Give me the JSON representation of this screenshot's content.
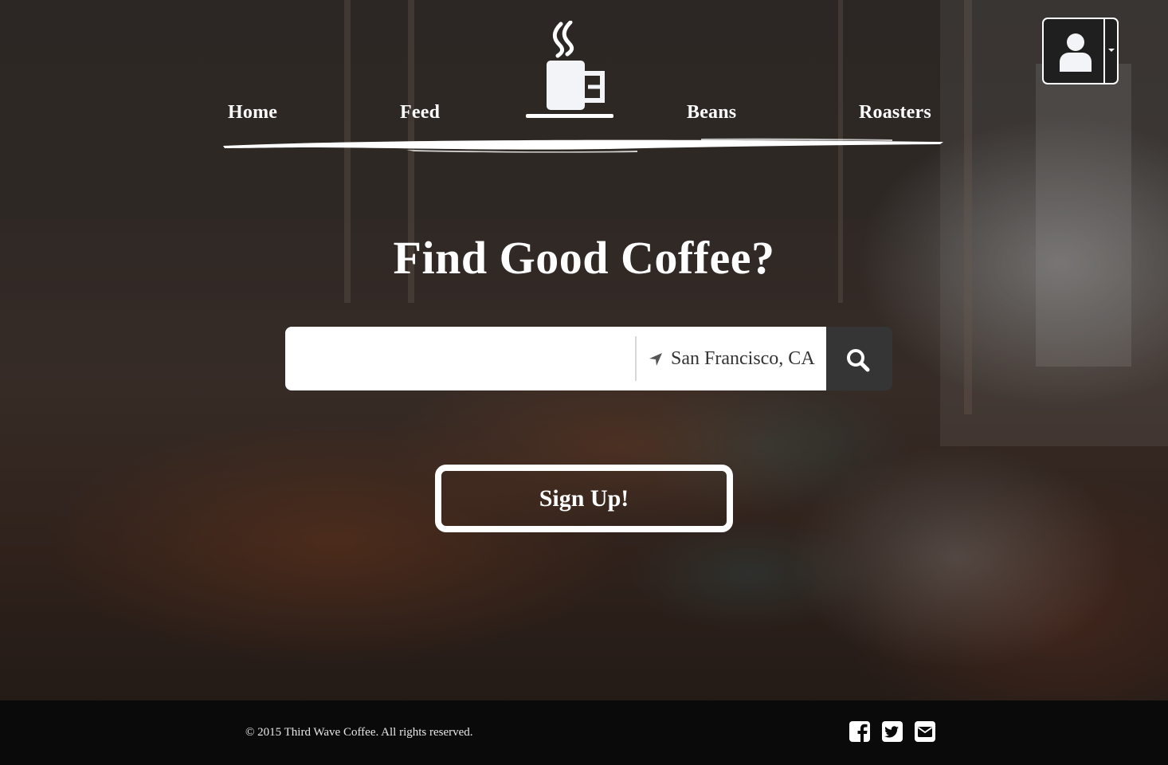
{
  "nav": {
    "links": [
      {
        "label": "Home"
      },
      {
        "label": "Feed"
      },
      {
        "label": "Beans"
      },
      {
        "label": "Roasters"
      }
    ],
    "logo_icon": "coffee-mug-icon",
    "user_menu_icon": "user-icon"
  },
  "hero": {
    "title": "Find Good Coffee?",
    "search": {
      "query_value": "",
      "location_value": "San Francisco, CA",
      "location_icon": "location-arrow-icon",
      "button_icon": "search-icon"
    },
    "signup_label": "Sign Up!"
  },
  "footer": {
    "copyright": "© 2015 Third Wave Coffee. All rights reserved.",
    "social_icons": [
      "facebook-icon",
      "twitter-icon",
      "email-icon"
    ]
  },
  "colors": {
    "footer_bg": "#0a0a0a",
    "search_button_bg": "#353535",
    "text": "#ffffff"
  }
}
